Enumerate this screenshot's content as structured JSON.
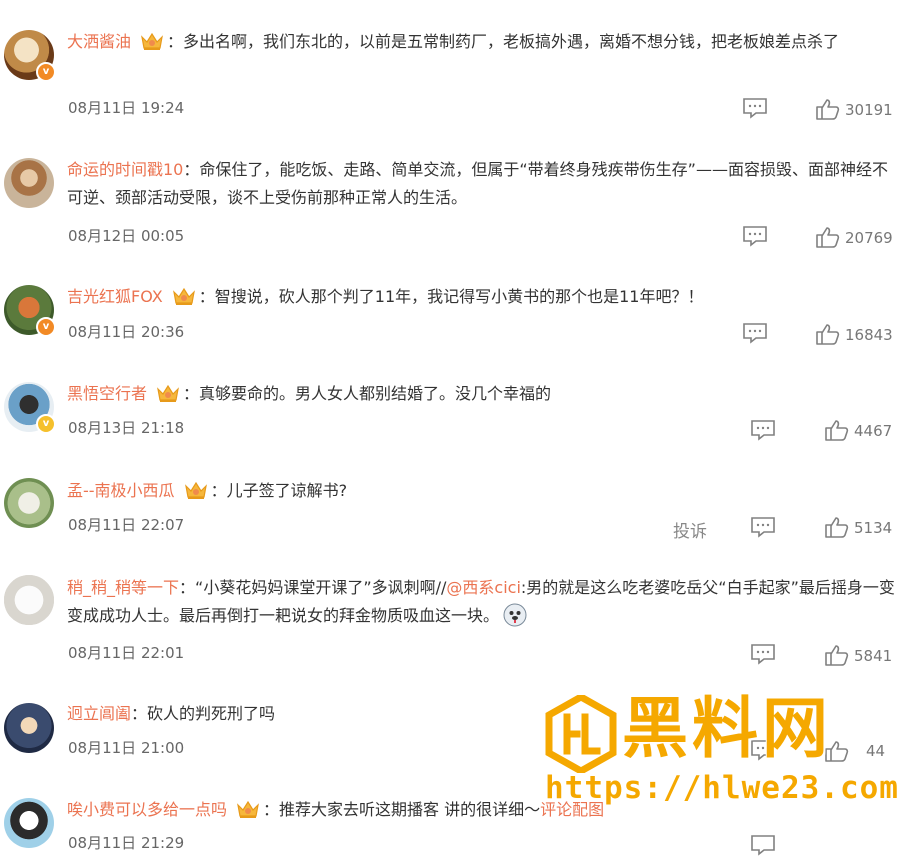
{
  "comments": [
    {
      "username": "大洒酱油",
      "vip": true,
      "verified": "orange",
      "text": "多出名啊，我们东北的，以前是五常制药厂，老板搞外遇，离婚不想分钱，把老板娘差点杀了",
      "time": "08月11日 19:24",
      "likes": "30191"
    },
    {
      "username": "命运的时间戳10",
      "vip": false,
      "verified": "",
      "text": "命保住了，能吃饭、走路、简单交流，但属于“带着终身残疾带伤生存”——面容损毁、面部神经不可逆、颈部活动受限，谈不上受伤前那种正常人的生活。",
      "time": "08月12日 00:05",
      "likes": "20769"
    },
    {
      "username": "吉光红狐FOX",
      "vip": true,
      "verified": "orange",
      "text": "智搜说，砍人那个判了11年，我记得写小黄书的那个也是11年吧？！",
      "time": "08月11日 20:36",
      "likes": "16843"
    },
    {
      "username": "黑悟空行者",
      "vip": true,
      "verified": "yellow",
      "text": "真够要命的。男人女人都别结婚了。没几个幸福的",
      "time": "08月13日 21:18",
      "likes": "4467"
    },
    {
      "username": "孟--南极小西瓜",
      "vip": true,
      "verified": "",
      "text": "儿子签了谅解书?",
      "time": "08月11日 22:07",
      "likes": "5134",
      "report": "投诉"
    },
    {
      "username": "稍_稍_稍等一下",
      "vip": false,
      "verified": "",
      "text_a": "“小葵花妈妈课堂开课了”多讽刺啊//",
      "mention": "@西系cici",
      "text_b": ":男的就是这么吃老婆吃岳父“白手起家”最后摇身一变变成成功人士。最后再倒打一耙说女的拜金物质吸血这一块。",
      "emoji": "doge-emoji",
      "time": "08月11日 22:01",
      "likes": "5841"
    },
    {
      "username": "迥立阊阖",
      "vip": false,
      "verified": "",
      "text": "砍人的判死刑了吗",
      "time": "08月11日 21:00",
      "likes": "44"
    },
    {
      "username": "唉小费可以多给一点吗",
      "vip": true,
      "verified": "",
      "text": "推荐大家去听这期播客 讲的很详细～",
      "link": "评论配图",
      "time": "08月11日 21:29",
      "likes": ""
    }
  ],
  "watermark": {
    "brand": "黑料网",
    "url": "https://hlwe23.com"
  },
  "colon": "："
}
